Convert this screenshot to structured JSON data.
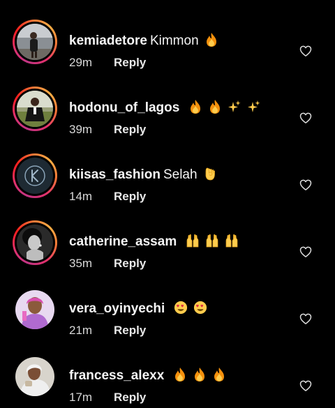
{
  "comments": [
    {
      "username": "kemiadetore",
      "text": "Kimmon",
      "emojis": [
        "fire"
      ],
      "time": "29m",
      "reply_label": "Reply",
      "ring": true
    },
    {
      "username": "hodonu_of_lagos",
      "text": "",
      "emojis": [
        "fire",
        "fire",
        "sparkles",
        "sparkles"
      ],
      "time": "39m",
      "reply_label": "Reply",
      "ring": true
    },
    {
      "username": "kiisas_fashion",
      "text": "Selah",
      "emojis": [
        "ok-hand"
      ],
      "time": "14m",
      "reply_label": "Reply",
      "ring": true
    },
    {
      "username": "catherine_assam",
      "text": "",
      "emojis": [
        "raised-hands",
        "raised-hands",
        "raised-hands"
      ],
      "time": "35m",
      "reply_label": "Reply",
      "ring": true
    },
    {
      "username": "vera_oyinyechi",
      "text": "",
      "emojis": [
        "heart-eyes",
        "heart-eyes"
      ],
      "time": "21m",
      "reply_label": "Reply",
      "ring": false
    },
    {
      "username": "francess_alexx",
      "text": "",
      "emojis": [
        "fire",
        "fire",
        "fire"
      ],
      "time": "17m",
      "reply_label": "Reply",
      "ring": false
    }
  ],
  "icons": {
    "like": "heart-outline-icon"
  },
  "colors": {
    "background": "#000000",
    "text": "#f5f5f5",
    "story_ring_start": "#c13584",
    "story_ring_end": "#fcaf45"
  }
}
